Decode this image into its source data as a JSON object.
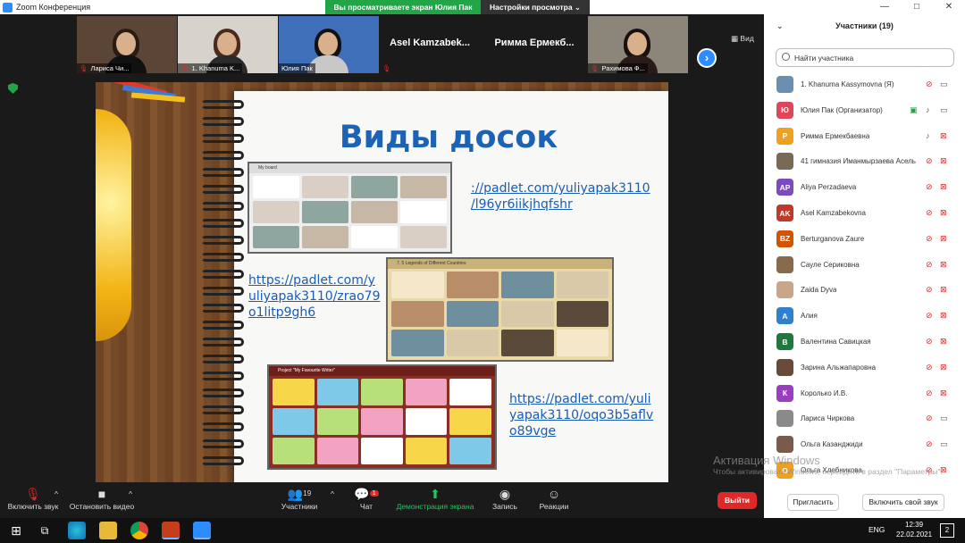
{
  "window": {
    "title": "Zoom Конференция",
    "controls": [
      "—",
      "□",
      "✕"
    ]
  },
  "share_banner": {
    "viewing_text": "Вы просматриваете экран Юлия Пак",
    "view_settings": "Настройки просмотра ⌄"
  },
  "video_strip": {
    "view_label": "Вид",
    "tiles": [
      {
        "name": "Лариса Чи...",
        "type": "video"
      },
      {
        "name": "1. Khanuma K...",
        "type": "video"
      },
      {
        "name": "Юлия Пак",
        "type": "video"
      },
      {
        "name": "Asel  Kamzabek...",
        "type": "name"
      },
      {
        "name": "Римма  Ермекб...",
        "type": "name"
      },
      {
        "name": "Рахимова Ф...",
        "type": "video"
      }
    ]
  },
  "slide": {
    "title": "Виды досок",
    "links": [
      [
        "://padlet.com/yuliyapak3110",
        "/l96yr6iikjhqfshr"
      ],
      [
        "https://padlet.com/y",
        "uliyapak3110/zrao79",
        "o1litp9gh6"
      ],
      [
        "https://padlet.com/yuli",
        "yapak3110/oqo3b5aflv",
        "o89vge"
      ]
    ],
    "shots": [
      {
        "header": "My board",
        "bar_color": "#f3f3f3"
      },
      {
        "header": "7. 5 Legends of Different Countries",
        "bar_color": "#e9d9a8"
      },
      {
        "header": "Project \"My Favourite Writer\"",
        "bar_color": "#8b2f24"
      }
    ]
  },
  "participants": {
    "header": "Участники (19)",
    "search_placeholder": "Найти участника",
    "list": [
      {
        "name": "1. Khanuma Kassymovna (Я)",
        "initial": "",
        "color": "#6a8fb0",
        "mic": "muted",
        "video": "on"
      },
      {
        "name": "Юлия Пак (Организатор)",
        "initial": "Ю",
        "color": "#e0465a",
        "mic": "on",
        "video": "on",
        "sharing": true
      },
      {
        "name": "Римма Ермекбаевна",
        "initial": "Р",
        "color": "#f0a020",
        "mic": "on",
        "video": "off"
      },
      {
        "name": "41 гимназия Иманмырзаева Асель",
        "initial": "",
        "color": "#7a6a55",
        "mic": "muted",
        "video": "off"
      },
      {
        "name": "Aliya Perzadaeva",
        "initial": "AP",
        "color": "#7b4bbf",
        "mic": "muted",
        "video": "off"
      },
      {
        "name": "Asel Kamzabekovna",
        "initial": "AK",
        "color": "#c0392b",
        "mic": "muted",
        "video": "off"
      },
      {
        "name": "Berturganova Zaure",
        "initial": "BZ",
        "color": "#d35400",
        "mic": "muted",
        "video": "off"
      },
      {
        "name": "Сауле Сериковна",
        "initial": "",
        "color": "#8a6a4a",
        "mic": "muted",
        "video": "off"
      },
      {
        "name": "Zaida Dyva",
        "initial": "",
        "color": "#c9a58a",
        "mic": "muted",
        "video": "off"
      },
      {
        "name": "Алия",
        "initial": "А",
        "color": "#2f80d0",
        "mic": "muted",
        "video": "off"
      },
      {
        "name": "Валентина Савицкая",
        "initial": "В",
        "color": "#1e7a3a",
        "mic": "muted",
        "video": "off"
      },
      {
        "name": "Зарина Альжапаровна",
        "initial": "",
        "color": "#6a4a3a",
        "mic": "muted",
        "video": "off"
      },
      {
        "name": "Королько И.В.",
        "initial": "К",
        "color": "#9b3dbf",
        "mic": "muted",
        "video": "off"
      },
      {
        "name": "Лариса Чиркова",
        "initial": "",
        "color": "#8a8a8a",
        "mic": "muted",
        "video": "on"
      },
      {
        "name": "Ольга Казанджиди",
        "initial": "",
        "color": "#7a5a4a",
        "mic": "muted",
        "video": "on"
      },
      {
        "name": "Ольга Хлебникова",
        "initial": "О",
        "color": "#f0a020",
        "mic": "muted",
        "video": "off"
      }
    ],
    "invite_label": "Пригласить",
    "unmute_label": "Включить свой звук"
  },
  "toolbar": {
    "unmute": "Включить звук",
    "stop_video": "Остановить видео",
    "participants": "Участники",
    "participants_count": "19",
    "chat": "Чат",
    "chat_badge": "1",
    "share_screen": "Демонстрация экрана",
    "record": "Запись",
    "reactions": "Реакции",
    "leave": "Выйти"
  },
  "watermark": {
    "title": "Активация Windows",
    "text": "Чтобы активировать Windows, перейдите в раздел \"Параметры\"."
  },
  "taskbar": {
    "lang": "ENG",
    "time": "12:39",
    "date": "22.02.2021",
    "notifications": "2"
  }
}
